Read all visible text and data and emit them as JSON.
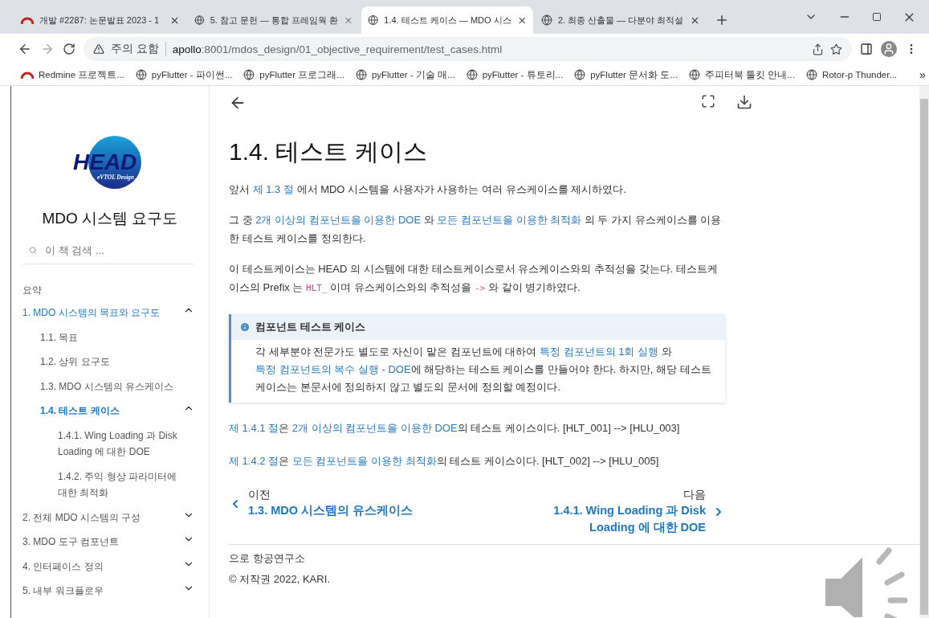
{
  "browser": {
    "tabs": [
      {
        "title": "개발 #2287: 논문발표 2023 - 1",
        "kind": "redmine",
        "selected": false
      },
      {
        "title": "5. 참고 문헌 — 통합 프레임웍 환",
        "kind": "globe",
        "selected": false
      },
      {
        "title": "1.4. 테스트 케이스 — MDO 시스",
        "kind": "globe",
        "selected": true
      },
      {
        "title": "2. 최종 산출물 — 다분야 최적설",
        "kind": "globe",
        "selected": false
      }
    ],
    "security": "주의 요함",
    "url_host": "apollo",
    "url_rest": ":8001/mdos_design/01_objective_requirement/test_cases.html",
    "bookmarks": [
      {
        "label": "Redmine 프로젝트...",
        "kind": "redmine"
      },
      {
        "label": "pyFlutter - 파이썬...",
        "kind": "globe"
      },
      {
        "label": "pyFlutter 프로그래...",
        "kind": "globe"
      },
      {
        "label": "pyFlutter - 기술 매...",
        "kind": "globe"
      },
      {
        "label": "pyFlutter - 튜토리...",
        "kind": "globe"
      },
      {
        "label": "pyFlutter 문서화 도...",
        "kind": "globe"
      },
      {
        "label": "주피터북 툴킷 안내...",
        "kind": "globe"
      },
      {
        "label": "Rotor-p Thunder...",
        "kind": "globe"
      }
    ],
    "more": "»"
  },
  "sidebar": {
    "logo": {
      "word": "HEAD",
      "tagline": "eVTOL Design"
    },
    "title": "MDO 시스템 요구도",
    "search": {
      "placeholder": "이 책 검색 ..."
    },
    "caption": "요약",
    "items": [
      {
        "label": "1. MDO 시스템의 목표와 요구도",
        "selected": false,
        "expanded": true,
        "children": [
          {
            "label": "1.1. 목표",
            "selected": false
          },
          {
            "label": "1.2. 상위 요구도",
            "selected": false
          },
          {
            "label": "1.3. MDO 시스템의 유스케이스",
            "selected": false
          },
          {
            "label": "1.4. 테스트 케이스",
            "selected": true,
            "expanded": true,
            "children": [
              {
                "label": "1.4.1. Wing Loading 과 Disk Loading 에 대한 DOE",
                "selected": false
              },
              {
                "label": "1.4.2. 주익 형상 파라미터에 대한 최적화",
                "selected": false
              }
            ]
          }
        ]
      },
      {
        "label": "2. 전체 MDO 시스템의 구성",
        "selected": false,
        "expanded": false
      },
      {
        "label": "3. MDO 도구 컴포넌트",
        "selected": false,
        "expanded": false
      },
      {
        "label": "4. 인터페이스 정의",
        "selected": false,
        "expanded": false
      },
      {
        "label": "5. 내부 워크플로우",
        "selected": false,
        "expanded": false
      }
    ]
  },
  "content": {
    "heading": "1.4. 테스트 케이스",
    "paragraphs": [
      [
        {
          "kind": "text",
          "text": "앞서 "
        },
        {
          "kind": "link",
          "text": "제 1.3 절"
        },
        {
          "kind": "text",
          "text": " 에서 MDO 시스템을 사용자가 사용하는 여러 유스케이스를 제시하였다."
        }
      ],
      [
        {
          "kind": "text",
          "text": "그 중 "
        },
        {
          "kind": "link",
          "text": "2개 이상의 컴포넌트을 이용한 DOE"
        },
        {
          "kind": "text",
          "text": " 와 "
        },
        {
          "kind": "link",
          "text": "모든 컴포넌트을 이용한 최적화"
        },
        {
          "kind": "text",
          "text": " 의 두 가지 유스케이스를 이용한 테스트 케이스를 정의한다."
        }
      ],
      [
        {
          "kind": "text",
          "text": "이 테스트케이스는 HEAD 의 시스템에 대한 테스트케이스로서 유스케이스와의 추적성을 갖는다. 테스트케이스의 Prefix 는 "
        },
        {
          "kind": "code",
          "text": "HLT_"
        },
        {
          "kind": "text",
          "text": " 이며 유스케이스와의 추적성을 "
        },
        {
          "kind": "code",
          "text": "->"
        },
        {
          "kind": "text",
          "text": " 와 같이 병기하였다."
        }
      ]
    ],
    "note": {
      "title": "컴포넌트 테스트 케이스",
      "body": [
        {
          "kind": "text",
          "text": "각 세부분야 전문가도 별도로 자신이 맡은 컴포넌트에 대하여 "
        },
        {
          "kind": "link",
          "text": "특정 컴포넌트의 1회 실행"
        },
        {
          "kind": "text",
          "text": " 와 "
        },
        {
          "kind": "link",
          "text": "특정 컴포넌트의 복수 실행 - DOE"
        },
        {
          "kind": "text",
          "text": "에 해당하는 테스트 케이스를 만들어야 한다. 하지만, 해당 테스트 케이스는 본문서에 정의하지 않고 별도의 문서에 정의할 예정이다."
        }
      ]
    },
    "after": [
      [
        {
          "kind": "link",
          "text": "제 1.4.1 절"
        },
        {
          "kind": "text",
          "text": "은 "
        },
        {
          "kind": "link",
          "text": "2개 이상의 컴포넌트을 이용한 DOE"
        },
        {
          "kind": "text",
          "text": "의 테스트 케이스이다. [HLT_001] --> [HLU_003]"
        }
      ],
      [
        {
          "kind": "link",
          "text": "제 1.4.2 절"
        },
        {
          "kind": "text",
          "text": "은 "
        },
        {
          "kind": "link",
          "text": "모든 컴포넌트을 이용한 최적화"
        },
        {
          "kind": "text",
          "text": "의 테스트 케이스이다. [HLT_002] --> [HLU_005]"
        }
      ]
    ],
    "prev": {
      "label": "이전",
      "title": "1.3. MDO 시스템의 유스케이스"
    },
    "next": {
      "label": "다음",
      "title": "1.4.1. Wing Loading 과 Disk Loading 에 대한 DOE"
    },
    "footer": [
      "으로 항공연구소",
      "© 저작권 2022, KARI."
    ]
  }
}
